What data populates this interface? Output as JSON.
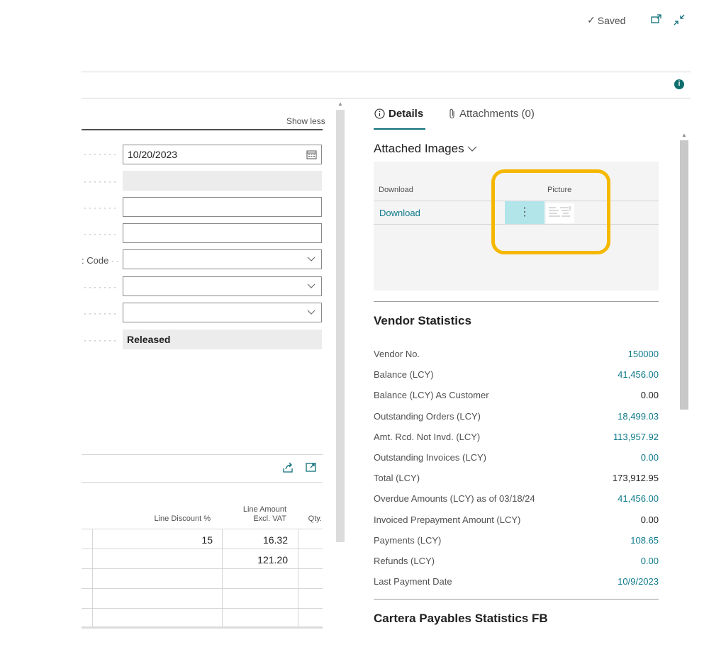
{
  "header": {
    "saved_label": "Saved"
  },
  "left": {
    "show_less": "Show less",
    "date_value": "10/20/2023",
    "code_label_partial": ": Code",
    "status_value": "Released"
  },
  "lines_table": {
    "headers": {
      "line_discount": "Line Discount %",
      "line_amount_1": "Line Amount",
      "line_amount_2": "Excl. VAT",
      "qty": "Qty."
    },
    "rows": [
      {
        "line_discount": "15",
        "line_amount": "16.32"
      },
      {
        "line_discount": "",
        "line_amount": "121.20"
      }
    ]
  },
  "tabs": {
    "details": "Details",
    "attachments": "Attachments (0)"
  },
  "attached_images": {
    "title": "Attached Images",
    "col_download": "Download",
    "col_picture": "Picture",
    "row_download": "Download"
  },
  "vendor_statistics": {
    "title": "Vendor Statistics",
    "rows": [
      {
        "label": "Vendor No.",
        "value": "150000",
        "link": true
      },
      {
        "label": "Balance (LCY)",
        "value": "41,456.00",
        "link": true
      },
      {
        "label": "Balance (LCY) As Customer",
        "value": "0.00",
        "link": false
      },
      {
        "label": "Outstanding Orders (LCY)",
        "value": "18,499.03",
        "link": true
      },
      {
        "label": "Amt. Rcd. Not Invd. (LCY)",
        "value": "113,957.92",
        "link": true
      },
      {
        "label": "Outstanding Invoices (LCY)",
        "value": "0.00",
        "link": true
      },
      {
        "label": "Total (LCY)",
        "value": "173,912.95",
        "link": false
      },
      {
        "label": "Overdue Amounts (LCY) as of 03/18/24",
        "value": "41,456.00",
        "link": true
      },
      {
        "label": "Invoiced Prepayment Amount (LCY)",
        "value": "0.00",
        "link": false
      },
      {
        "label": "Payments (LCY)",
        "value": "108.65",
        "link": true
      },
      {
        "label": "Refunds (LCY)",
        "value": "0.00",
        "link": true
      },
      {
        "label": "Last Payment Date",
        "value": "10/9/2023",
        "link": true
      }
    ]
  },
  "cartera": {
    "title": "Cartera Payables Statistics FB"
  },
  "colors": {
    "accent": "#0f7a8a",
    "highlight": "#f5b800",
    "selected_cell": "#b2e5ea"
  }
}
